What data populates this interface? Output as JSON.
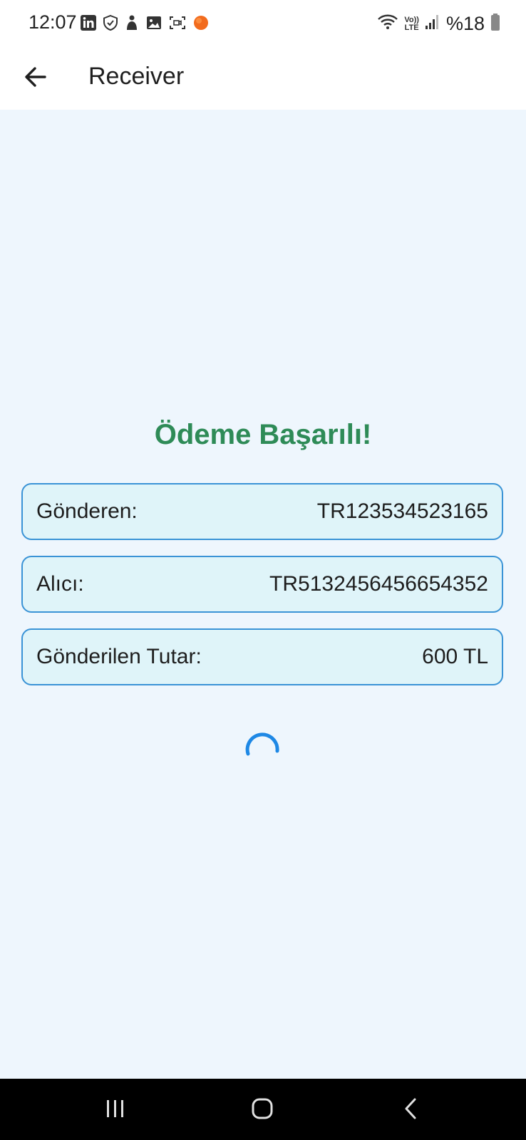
{
  "status_bar": {
    "time": "12:07",
    "battery_text": "%18",
    "left_icons": [
      "linkedin-icon",
      "shield-icon",
      "person-icon",
      "gallery-icon",
      "screen-record-icon",
      "notification-dot-icon"
    ],
    "right_icons": [
      "wifi-icon",
      "volte-icon",
      "signal-icon",
      "battery-icon"
    ],
    "volte_top": "Vo))",
    "volte_bottom": "LTE"
  },
  "app_bar": {
    "title": "Receiver",
    "back_icon": "arrow-left-icon"
  },
  "main": {
    "success_title": "Ödeme Başarılı!",
    "rows": [
      {
        "label": "Gönderen:",
        "value": "TR123534523165"
      },
      {
        "label": "Alıcı:",
        "value": "TR5132456456654352"
      },
      {
        "label": "Gönderilen Tutar:",
        "value": "600 TL"
      }
    ]
  },
  "nav_bar": {
    "recents_icon": "recents-icon",
    "home_icon": "home-icon",
    "back_icon": "back-chevron-icon"
  },
  "colors": {
    "success": "#2e8b57",
    "card_border": "#3a93d6",
    "card_bg": "#dff4f9",
    "page_bg": "#eef6fd",
    "spinner": "#1e88e5",
    "notification_dot": "#f26b1d"
  }
}
